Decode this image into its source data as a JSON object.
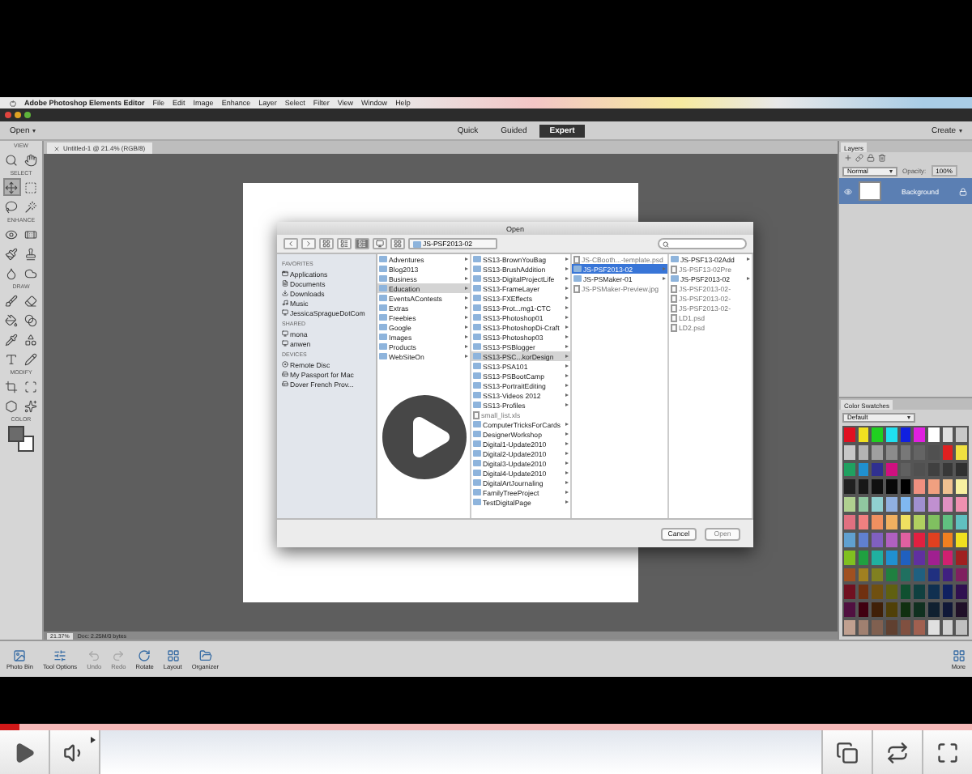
{
  "menu_bar": {
    "app_name": "Adobe Photoshop Elements Editor",
    "items": [
      "File",
      "Edit",
      "Image",
      "Enhance",
      "Layer",
      "Select",
      "Filter",
      "View",
      "Window",
      "Help"
    ]
  },
  "app_bar": {
    "open_label": "Open",
    "create_label": "Create",
    "modes": [
      {
        "label": "Quick",
        "selected": false
      },
      {
        "label": "Guided",
        "selected": false
      },
      {
        "label": "Expert",
        "selected": true
      }
    ]
  },
  "toolbox": {
    "sections": [
      {
        "label": "VIEW",
        "tools": [
          {
            "selected": false
          },
          {
            "selected": false
          }
        ]
      },
      {
        "label": "SELECT",
        "tools": [
          {
            "selected": true
          },
          {
            "selected": false
          },
          {
            "selected": false
          },
          {
            "selected": false
          }
        ]
      },
      {
        "label": "ENHANCE",
        "tools": [
          {
            "selected": false
          },
          {
            "selected": false
          },
          {
            "selected": false
          },
          {
            "selected": false
          },
          {
            "selected": false
          },
          {
            "selected": false
          }
        ]
      },
      {
        "label": "DRAW",
        "tools": [
          {
            "selected": false
          },
          {
            "selected": false
          },
          {
            "selected": false
          },
          {
            "selected": false
          },
          {
            "selected": false
          },
          {
            "selected": false
          },
          {
            "selected": false
          },
          {
            "selected": false
          }
        ]
      },
      {
        "label": "MODIFY",
        "tools": [
          {
            "selected": false
          },
          {
            "selected": false
          },
          {
            "selected": false
          },
          {
            "selected": false
          }
        ]
      },
      {
        "label": "COLOR"
      }
    ]
  },
  "document": {
    "tab_title": "Untitled-1 @ 21.4% (RGB/8)",
    "zoom": "21.37%",
    "doc_info": "Doc: 2.25M/0 bytes"
  },
  "open_dialog": {
    "title": "Open",
    "path": "JS-PSF2013-02",
    "sidebar": [
      {
        "heading": "FAVORITES",
        "items": [
          "Applications",
          "Documents",
          "Downloads",
          "Music",
          "JessicaSpragueDotCom"
        ]
      },
      {
        "heading": "SHARED",
        "items": [
          "mona",
          "anwen"
        ]
      },
      {
        "heading": "DEVICES",
        "items": [
          "Remote Disc",
          "My Passport for Mac",
          "Dover French Prov..."
        ]
      }
    ],
    "columns": [
      {
        "active": false,
        "items": [
          {
            "label": "Adventures",
            "kind": "folder",
            "selected": false,
            "disabled": false
          },
          {
            "label": "Blog2013",
            "kind": "folder",
            "selected": false,
            "disabled": false
          },
          {
            "label": "Business",
            "kind": "folder",
            "selected": false,
            "disabled": false
          },
          {
            "label": "Education",
            "kind": "folder",
            "selected": true,
            "disabled": false
          },
          {
            "label": "EventsAContests",
            "kind": "folder",
            "selected": false,
            "disabled": false
          },
          {
            "label": "Extras",
            "kind": "folder",
            "selected": false,
            "disabled": false
          },
          {
            "label": "Freebies",
            "kind": "folder",
            "selected": false,
            "disabled": false
          },
          {
            "label": "Google",
            "kind": "folder",
            "selected": false,
            "disabled": false
          },
          {
            "label": "Images",
            "kind": "folder",
            "selected": false,
            "disabled": false
          },
          {
            "label": "Products",
            "kind": "folder",
            "selected": false,
            "disabled": false
          },
          {
            "label": "WebSiteOn",
            "kind": "folder",
            "selected": false,
            "disabled": false
          }
        ]
      },
      {
        "active": false,
        "items": [
          {
            "label": "SS13-BrownYouBag",
            "kind": "folder",
            "selected": false,
            "disabled": false
          },
          {
            "label": "SS13-BrushAddition",
            "kind": "folder",
            "selected": false,
            "disabled": false
          },
          {
            "label": "SS13-DigitalProjectLife",
            "kind": "folder",
            "selected": false,
            "disabled": false
          },
          {
            "label": "SS13-FrameLayer",
            "kind": "folder",
            "selected": false,
            "disabled": false
          },
          {
            "label": "SS13-FXEffects",
            "kind": "folder",
            "selected": false,
            "disabled": false
          },
          {
            "label": "SS13-Prot...mg1-CTC",
            "kind": "folder",
            "selected": false,
            "disabled": false
          },
          {
            "label": "SS13-Photoshop01",
            "kind": "folder",
            "selected": false,
            "disabled": false
          },
          {
            "label": "SS13-PhotoshopDi-Craft",
            "kind": "folder",
            "selected": false,
            "disabled": false
          },
          {
            "label": "SS13-Photoshop03",
            "kind": "folder",
            "selected": false,
            "disabled": false
          },
          {
            "label": "SS13-PSBlogger",
            "kind": "folder",
            "selected": false,
            "disabled": false
          },
          {
            "label": "SS13-PSC...korDesign",
            "kind": "folder",
            "selected": true,
            "disabled": false
          },
          {
            "label": "SS13-PSA101",
            "kind": "folder",
            "selected": false,
            "disabled": false
          },
          {
            "label": "SS13-PSBootCamp",
            "kind": "folder",
            "selected": false,
            "disabled": false
          },
          {
            "label": "SS13-PortraitEditing",
            "kind": "folder",
            "selected": false,
            "disabled": false
          },
          {
            "label": "SS13-Videos 2012",
            "kind": "folder",
            "selected": false,
            "disabled": false
          },
          {
            "label": "SS13-Profiles",
            "kind": "folder",
            "selected": false,
            "disabled": false
          },
          {
            "label": "small_list.xls",
            "kind": "file",
            "selected": false,
            "disabled": true
          },
          {
            "label": "ComputerTricksForCards",
            "kind": "folder",
            "selected": false,
            "disabled": false
          },
          {
            "label": "DesignerWorkshop",
            "kind": "folder",
            "selected": false,
            "disabled": false
          },
          {
            "label": "Digital1-Update2010",
            "kind": "folder",
            "selected": false,
            "disabled": false
          },
          {
            "label": "Digital2-Update2010",
            "kind": "folder",
            "selected": false,
            "disabled": false
          },
          {
            "label": "Digital3-Update2010",
            "kind": "folder",
            "selected": false,
            "disabled": false
          },
          {
            "label": "Digital4-Update2010",
            "kind": "folder",
            "selected": false,
            "disabled": false
          },
          {
            "label": "DigitalArtJournaling",
            "kind": "folder",
            "selected": false,
            "disabled": false
          },
          {
            "label": "FamilyTreeProject",
            "kind": "folder",
            "selected": false,
            "disabled": false
          },
          {
            "label": "TestDigitalPage",
            "kind": "folder",
            "selected": false,
            "disabled": false
          }
        ]
      },
      {
        "active": true,
        "items": [
          {
            "label": "JS-CBooth...-template.psd",
            "kind": "file",
            "selected": false,
            "disabled": true
          },
          {
            "label": "JS-PSF2013-02",
            "kind": "folder",
            "selected": true,
            "disabled": false
          },
          {
            "label": "JS-PSMaker-01",
            "kind": "folder",
            "selected": false,
            "disabled": false
          },
          {
            "label": "JS-PSMaker-Preview.jpg",
            "kind": "file",
            "selected": false,
            "disabled": true
          }
        ]
      },
      {
        "active": false,
        "items": [
          {
            "label": "JS-PSF13-02Add",
            "kind": "folder",
            "selected": false,
            "disabled": false
          },
          {
            "label": "JS-PSF13-02Pre",
            "kind": "file",
            "selected": false,
            "disabled": true
          },
          {
            "label": "JS-PSF2013-02",
            "kind": "folder",
            "selected": false,
            "disabled": false
          },
          {
            "label": "JS-PSF2013-02-",
            "kind": "file",
            "selected": false,
            "disabled": true
          },
          {
            "label": "JS-PSF2013-02-",
            "kind": "file",
            "selected": false,
            "disabled": true
          },
          {
            "label": "JS-PSF2013-02-",
            "kind": "file",
            "selected": false,
            "disabled": true
          },
          {
            "label": "LD1.psd",
            "kind": "file",
            "selected": false,
            "disabled": true
          },
          {
            "label": "LD2.psd",
            "kind": "file",
            "selected": false,
            "disabled": true
          }
        ]
      }
    ],
    "buttons": [
      {
        "label": "Cancel",
        "disabled": false
      },
      {
        "label": "Open",
        "disabled": true
      }
    ]
  },
  "layers_panel": {
    "tab": "Layers",
    "blend_mode": "Normal",
    "opacity_label": "Opacity:",
    "opacity": "100%",
    "layers": [
      {
        "name": "Background",
        "selected": true
      }
    ]
  },
  "swatches_panel": {
    "tab": "Color Swatches",
    "preset": "Default",
    "swatches": [
      {
        "color": "#e01020"
      },
      {
        "color": "#f0e020"
      },
      {
        "color": "#20d020"
      },
      {
        "color": "#20e0f0"
      },
      {
        "color": "#1020e0"
      },
      {
        "color": "#e020e0"
      },
      {
        "color": "#ffffff"
      },
      {
        "color": "#e0e0e0"
      },
      {
        "color": "#c8c8c8"
      },
      {
        "color": "#c8c8c8"
      },
      {
        "color": "#b4b4b4"
      },
      {
        "color": "#a0a0a0"
      },
      {
        "color": "#8c8c8c"
      },
      {
        "color": "#787878"
      },
      {
        "color": "#646464"
      },
      {
        "color": "#505050"
      },
      {
        "color": "#e02020"
      },
      {
        "color": "#f0e040"
      },
      {
        "color": "#20a060"
      },
      {
        "color": "#2090d0"
      },
      {
        "color": "#303090"
      },
      {
        "color": "#d01080"
      },
      {
        "color": "#606060"
      },
      {
        "color": "#505050"
      },
      {
        "color": "#404040"
      },
      {
        "color": "#383838"
      },
      {
        "color": "#303030"
      },
      {
        "color": "#202020"
      },
      {
        "color": "#181818"
      },
      {
        "color": "#101010"
      },
      {
        "color": "#080808"
      },
      {
        "color": "#000000"
      },
      {
        "color": "#f09080"
      },
      {
        "color": "#f0a080"
      },
      {
        "color": "#f0c090"
      },
      {
        "color": "#f8f0a0"
      },
      {
        "color": "#b0d090"
      },
      {
        "color": "#90c8a0"
      },
      {
        "color": "#90d0d0"
      },
      {
        "color": "#90b0e0"
      },
      {
        "color": "#80b8f0"
      },
      {
        "color": "#a090d0"
      },
      {
        "color": "#c090d0"
      },
      {
        "color": "#e090c0"
      },
      {
        "color": "#f090b0"
      },
      {
        "color": "#e07080"
      },
      {
        "color": "#f08080"
      },
      {
        "color": "#f09060"
      },
      {
        "color": "#f0b060"
      },
      {
        "color": "#f0e060"
      },
      {
        "color": "#b0d060"
      },
      {
        "color": "#80c060"
      },
      {
        "color": "#60c080"
      },
      {
        "color": "#60c0c0"
      },
      {
        "color": "#60a0d0"
      },
      {
        "color": "#6080d0"
      },
      {
        "color": "#8060c0"
      },
      {
        "color": "#b060c0"
      },
      {
        "color": "#e060a0"
      },
      {
        "color": "#e02040"
      },
      {
        "color": "#e04020"
      },
      {
        "color": "#f08020"
      },
      {
        "color": "#f0e020"
      },
      {
        "color": "#80c020"
      },
      {
        "color": "#20a040"
      },
      {
        "color": "#20b0a0"
      },
      {
        "color": "#2090d0"
      },
      {
        "color": "#2060c0"
      },
      {
        "color": "#6030a0"
      },
      {
        "color": "#a02090"
      },
      {
        "color": "#d02070"
      },
      {
        "color": "#a02020"
      },
      {
        "color": "#a05020"
      },
      {
        "color": "#a08020"
      },
      {
        "color": "#808020"
      },
      {
        "color": "#208040"
      },
      {
        "color": "#207060"
      },
      {
        "color": "#206080"
      },
      {
        "color": "#203080"
      },
      {
        "color": "#402080"
      },
      {
        "color": "#802060"
      },
      {
        "color": "#701020"
      },
      {
        "color": "#703010"
      },
      {
        "color": "#705010"
      },
      {
        "color": "#606010"
      },
      {
        "color": "#105030"
      },
      {
        "color": "#104040"
      },
      {
        "color": "#103050"
      },
      {
        "color": "#102060"
      },
      {
        "color": "#301050"
      },
      {
        "color": "#501040"
      },
      {
        "color": "#400010"
      },
      {
        "color": "#402008"
      },
      {
        "color": "#504008"
      },
      {
        "color": "#103010"
      },
      {
        "color": "#103020"
      },
      {
        "color": "#102030"
      },
      {
        "color": "#101838"
      },
      {
        "color": "#201028"
      },
      {
        "color": "#c0a090"
      },
      {
        "color": "#a08070"
      },
      {
        "color": "#806050"
      },
      {
        "color": "#604030"
      },
      {
        "color": "#805040"
      },
      {
        "color": "#a06050"
      },
      {
        "color": "#e0e0e0"
      },
      {
        "color": "#d0d0d0"
      },
      {
        "color": "#c0c0c0"
      }
    ]
  },
  "bottom_bar": {
    "items": [
      {
        "label": "Photo Bin",
        "disabled": false
      },
      {
        "label": "Tool Options",
        "disabled": false
      },
      {
        "label": "Undo",
        "disabled": true
      },
      {
        "label": "Redo",
        "disabled": true
      },
      {
        "label": "Rotate",
        "disabled": false
      },
      {
        "label": "Layout",
        "disabled": false
      },
      {
        "label": "Organizer",
        "disabled": false
      }
    ],
    "more_label": "More"
  },
  "video_player": {
    "progress": {
      "level": 0.02
    }
  }
}
